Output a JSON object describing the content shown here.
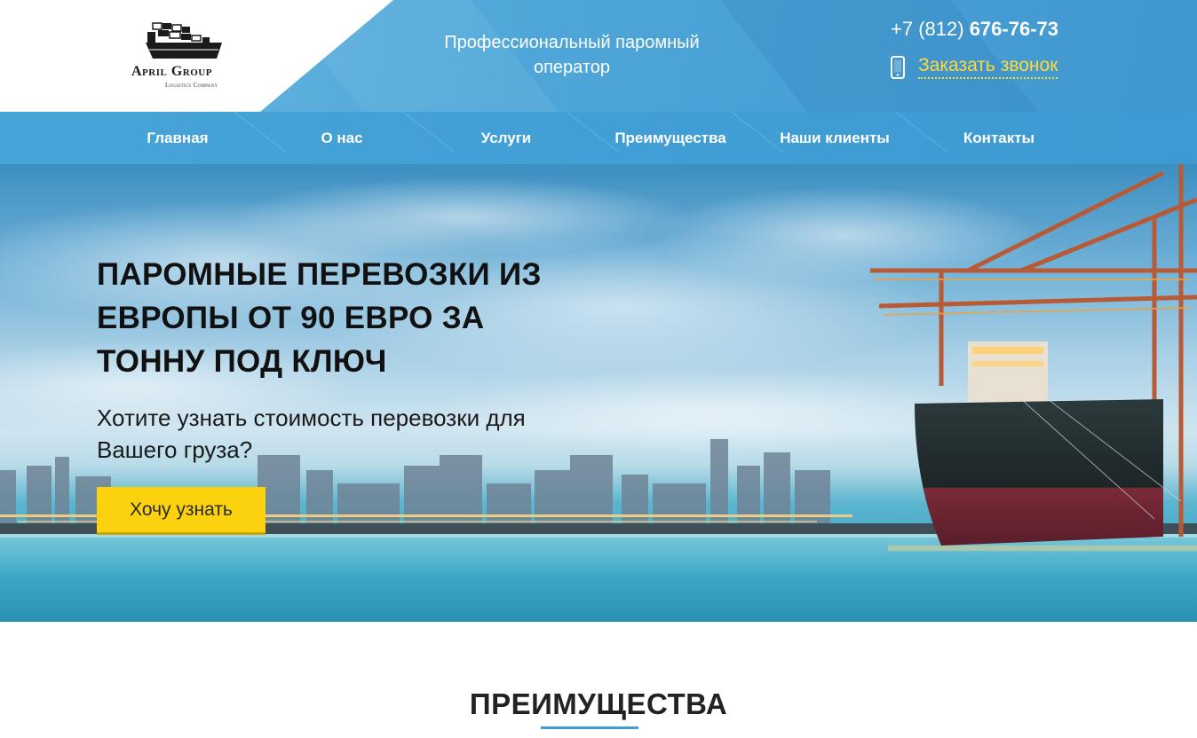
{
  "header": {
    "brand": "April Group",
    "brand_sub": "Logistics Company",
    "tagline": "Профессиональный паромный оператор",
    "phone_prefix": "+7 (812)",
    "phone_number": "676-76-73",
    "callback_label": "Заказать звонок",
    "icons": {
      "logo": "ship-icon",
      "callback": "mobile-phone-icon"
    }
  },
  "nav": {
    "items": [
      {
        "label": "Главная"
      },
      {
        "label": "О нас"
      },
      {
        "label": "Услуги"
      },
      {
        "label": "Преимущества"
      },
      {
        "label": "Наши клиенты"
      },
      {
        "label": "Контакты"
      }
    ]
  },
  "hero": {
    "title": "ПАРОМНЫЕ ПЕРЕВОЗКИ ИЗ ЕВРОПЫ ОТ 90 ЕВРО ЗА ТОННУ ПОД КЛЮЧ",
    "subtitle": "Хотите узнать стоимость перевозки для Вашего груза?",
    "cta_label": "Хочу узнать"
  },
  "section": {
    "title": "ПРЕИМУЩЕСТВА"
  },
  "colors": {
    "header_blue": "#4ea6d8",
    "nav_blue": "#3d9ad2",
    "accent_yellow": "#fcd20f",
    "callback_yellow": "#ffd93b",
    "underline_blue": "#3f9ed6"
  }
}
